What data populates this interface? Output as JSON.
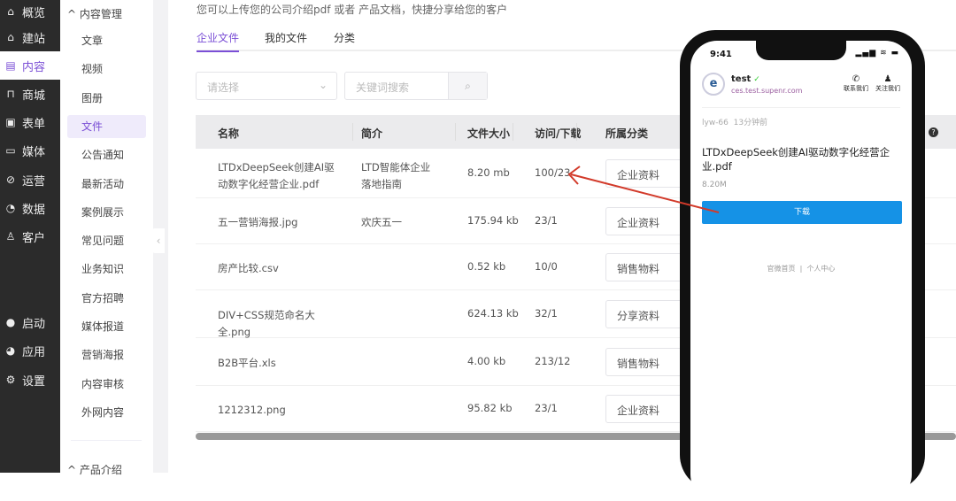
{
  "nav": [
    {
      "label": "概览",
      "icon": "monitor-icon",
      "glyph": "⌂"
    },
    {
      "label": "建站",
      "icon": "home-icon",
      "glyph": "⌂"
    },
    {
      "label": "内容",
      "icon": "document-icon",
      "glyph": "▤"
    },
    {
      "label": "商城",
      "icon": "shop-icon",
      "glyph": "⊓"
    },
    {
      "label": "表单",
      "icon": "form-icon",
      "glyph": "▣"
    },
    {
      "label": "媒体",
      "icon": "video-icon",
      "glyph": "▭"
    },
    {
      "label": "运营",
      "icon": "paperclip-icon",
      "glyph": "⊘"
    },
    {
      "label": "数据",
      "icon": "pie-chart-icon",
      "glyph": "◔"
    },
    {
      "label": "客户",
      "icon": "user-icon",
      "glyph": "♙"
    },
    {
      "label": "启动",
      "icon": "launch-icon",
      "glyph": "●"
    },
    {
      "label": "应用",
      "icon": "apps-icon",
      "glyph": "◕"
    },
    {
      "label": "设置",
      "icon": "gear-icon",
      "glyph": "⚙"
    }
  ],
  "sub": {
    "group": "内容管理",
    "group2": "产品介绍",
    "items": [
      "文章",
      "视频",
      "图册",
      "文件",
      "公告通知",
      "最新活动",
      "案例展示",
      "常见问题",
      "业务知识",
      "官方招聘",
      "媒体报道",
      "营销海报",
      "内容审核",
      "外网内容"
    ]
  },
  "main": {
    "description": "您可以上传您的公司介绍pdf 或者 产品文档，快捷分享给您的客户",
    "tabs": [
      "企业文件",
      "我的文件",
      "分类"
    ],
    "select_placeholder": "请选择",
    "search_placeholder": "关键词搜索",
    "columns": [
      "名称",
      "简介",
      "文件大小",
      "访问/下载",
      "所属分类"
    ],
    "rows": [
      {
        "name": "LTDxDeepSeek创建AI驱动数字化经营企业.pdf",
        "intro": "LTD智能体企业落地指南",
        "size": "8.20 mb",
        "visits": "100/23",
        "category": "企业资料"
      },
      {
        "name": "五一营销海报.jpg",
        "intro": "欢庆五一",
        "size": "175.94 kb",
        "visits": "23/1",
        "category": "企业资料"
      },
      {
        "name": "房产比较.csv",
        "intro": "",
        "size": "0.52 kb",
        "visits": "10/0",
        "category": "销售物料"
      },
      {
        "name": "DIV+CSS规范命名大全.png",
        "intro": "",
        "size": "624.13 kb",
        "visits": "32/1",
        "category": "分享资料"
      },
      {
        "name": "B2B平台.xls",
        "intro": "",
        "size": "4.00 kb",
        "visits": "213/12",
        "category": "销售物料"
      },
      {
        "name": "1212312.png",
        "intro": "",
        "size": "95.82 kb",
        "visits": "23/1",
        "category": "企业资料"
      }
    ]
  },
  "phone": {
    "time": "9:41",
    "status": "▂▄▆ ≋ ▬",
    "brand": "test",
    "url": "ces.test.supenr.com",
    "logo": "e",
    "contact": "联系我们",
    "follow": "关注我们",
    "author": "lyw-66",
    "ago": "13分钟前",
    "file_title": "LTDxDeepSeek创建AI驱动数字化经营企业.pdf",
    "file_size": "8.20M",
    "download": "下载",
    "footer_home": "官微首页",
    "footer_sep": "|",
    "footer_me": "个人中心"
  },
  "colors": {
    "accent": "#7b4fd6",
    "download": "#1592e6",
    "arrow": "#d23a2a"
  }
}
